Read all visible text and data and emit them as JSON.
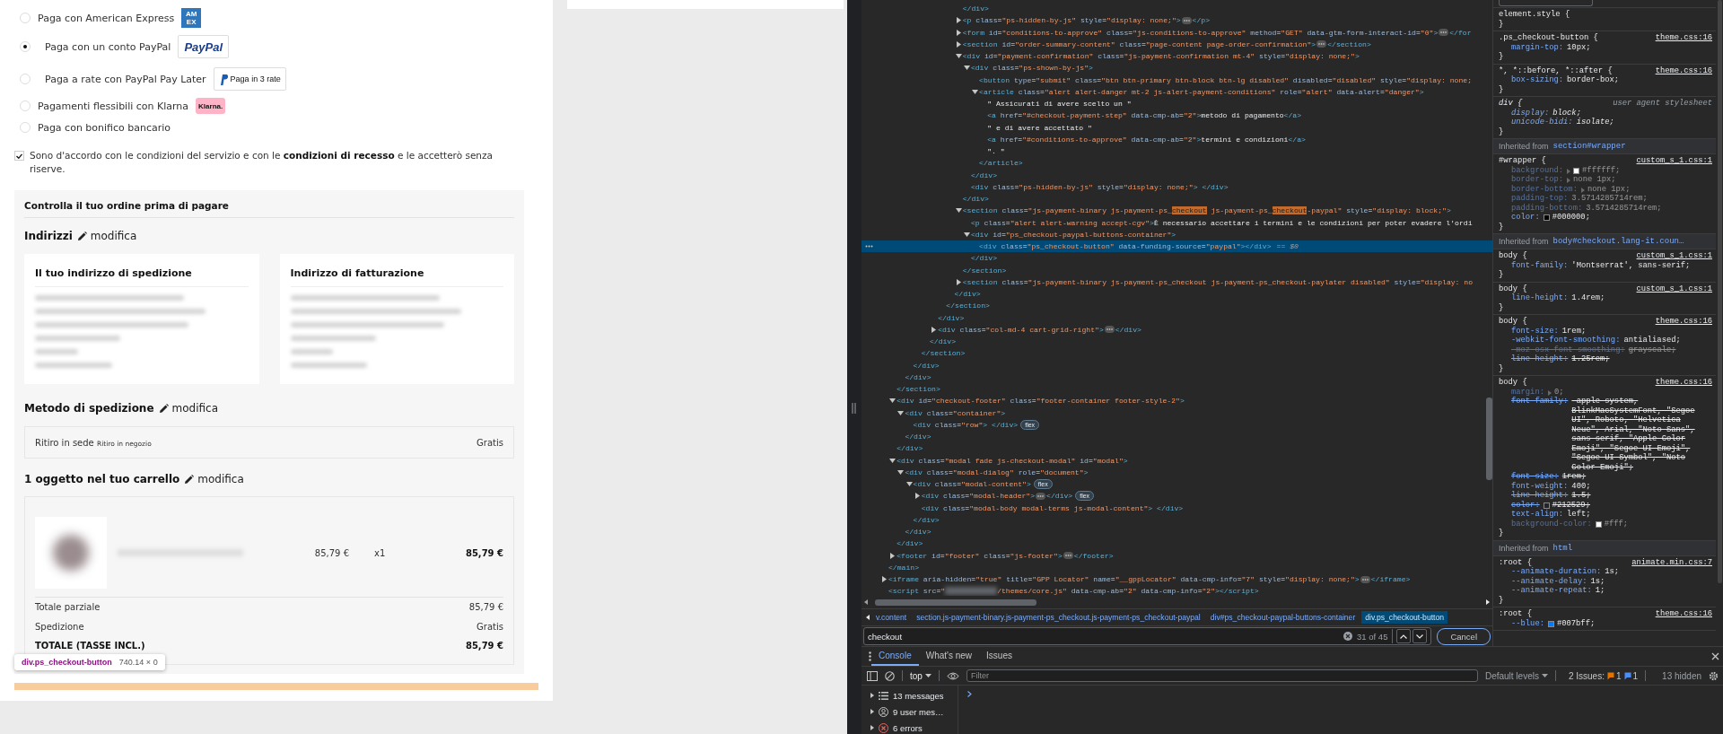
{
  "checkout": {
    "payment_options": [
      {
        "label": "Paga con American Express",
        "selected": false,
        "kind": "amex",
        "logo_text": "AMEX"
      },
      {
        "label": "Paga con un conto PayPal",
        "selected": true,
        "kind": "paypal",
        "logo_text": "PayPal"
      },
      {
        "label": "Paga a rate con PayPal Pay Later",
        "selected": false,
        "kind": "paylater",
        "logo_text": "Paga in 3 rate"
      },
      {
        "label": "Pagamenti flessibili con Klarna",
        "selected": false,
        "kind": "klarna",
        "logo_text": "Klarna."
      },
      {
        "label": "Paga con bonifico bancario",
        "selected": false,
        "kind": "plain"
      }
    ],
    "terms": {
      "checked": true,
      "parts": [
        {
          "kind": "text",
          "text": "Sono d'accordo con le "
        },
        {
          "kind": "link",
          "text": "condizioni del servizio"
        },
        {
          "kind": "text",
          "text": " e con le "
        },
        {
          "kind": "strong_link",
          "text": "condizioni di recesso"
        },
        {
          "kind": "text",
          "text": " e le accetterò senza riserve."
        }
      ]
    },
    "review_title": "Controlla il tuo ordine prima di pagare",
    "addresses": {
      "heading": "Indirizzi",
      "edit": "modifica",
      "cards": [
        {
          "title": "Il tuo indirizzo di spedizione"
        },
        {
          "title": "Indirizzo di fatturazione"
        }
      ]
    },
    "shipping": {
      "heading": "Metodo di spedizione",
      "edit": "modifica",
      "carrier": "Ritiro in sede",
      "delay": "Ritiro in negozio",
      "price": "Gratis"
    },
    "cart": {
      "heading": "1 oggetto nel tuo carrello",
      "edit": "modifica",
      "items": [
        {
          "unit_price": "85,79 €",
          "quantity": "x1",
          "total": "85,79 €"
        }
      ],
      "totals": [
        {
          "label": "Totale parziale",
          "value": "85,79 €",
          "kind": "plain"
        },
        {
          "label": "Spedizione",
          "value": "Gratis",
          "kind": "plain"
        },
        {
          "label": "TOTALE (TASSE INCL.)",
          "value": "85,79 €",
          "kind": "grand"
        }
      ]
    },
    "inspect_tooltip": {
      "selector": "div.ps_checkout-button",
      "size": "740.14 × 0"
    }
  },
  "devtools": {
    "dom_tree": [
      {
        "close": "</main>",
        "children": [
          {
            "close": "</section>",
            "children": [
              {
                "close": "</div>",
                "children": [
                  {
                    "close": "</div>",
                    "children": [
                      {
                        "close": "</section>",
                        "children": [
                          {
                            "close": "</div>",
                            "children": [
                              {
                                "close": "</div>",
                                "children": [
                                  {
                                    "close": "</section>",
                                    "children": [
                                      {
                                        "close": "</div>",
                                        "children": [
                                          {
                                            "close": "</div>"
                                          },
                                          {
                                            "open": "<p class=\"ps-hidden-by-js\" style=\"display: none;\">",
                                            "expanded": false,
                                            "close": "</p>",
                                            "selected": false
                                          },
                                          {
                                            "open": "<form id=\"conditions-to-approve\" class=\"js-conditions-to-approve\" method=\"GET\" data-gtm-form-interact-id=\"0\">",
                                            "expanded": false,
                                            "close": "</for",
                                            "selected": false
                                          },
                                          {
                                            "open": "<section id=\"order-summary-content\" class=\"page-content page-order-confirmation\">",
                                            "expanded": false,
                                            "close": "</section>",
                                            "selected": false
                                          },
                                          {
                                            "open": "<div id=\"payment-confirmation\" class=\"js-payment-confirmation mt-4\" style=\"display: none;\">",
                                            "expanded": true,
                                            "close": "</div>",
                                            "selected": false,
                                            "children": [
                                              {
                                                "open": "<div class=\"ps-shown-by-js\">",
                                                "expanded": true,
                                                "close": "</div>",
                                                "selected": false,
                                                "children": [
                                                  {
                                                    "open": "<button type=\"submit\" class=\"btn btn-primary btn-block btn-lg disabled\" disabled=\"disabled\" style=\"display: none;",
                                                    "selected": false
                                                  },
                                                  {
                                                    "open": "<article class=\"alert alert-danger mt-2 js-alert-payment-conditions\" role=\"alert\" data-alert=\"danger\">",
                                                    "expanded": true,
                                                    "close": "</article>",
                                                    "selected": false,
                                                    "children": [
                                                      {
                                                        "open": "\" Assicurati di avere scelto un \"",
                                                        "kind": "text",
                                                        "selected": false
                                                      },
                                                      {
                                                        "open": "<a href=\"#checkout-payment-step\" data-cmp-ab=\"2\">metodo di pagamento</a>",
                                                        "kind": "element",
                                                        "selected": false
                                                      },
                                                      {
                                                        "open": "\" e di avere accettato \"",
                                                        "kind": "text",
                                                        "selected": false
                                                      },
                                                      {
                                                        "open": "<a href=\"#conditions-to-approve\" data-cmp-ab=\"2\">termini e condizioni</a>",
                                                        "kind": "element",
                                                        "selected": false
                                                      },
                                                      {
                                                        "open": "\". \"",
                                                        "kind": "text",
                                                        "selected": false
                                                      }
                                                    ]
                                                  }
                                                ]
                                              },
                                              {
                                                "open": "<div class=\"ps-hidden-by-js\" style=\"display: none;\"> </div>",
                                                "selected": false
                                              }
                                            ]
                                          },
                                          {
                                            "segments": [
                                              {
                                                "text": "<section class=\"js-payment-binary js-payment-ps_",
                                                "highlight": false
                                              },
                                              {
                                                "text": "checkout",
                                                "highlight": true
                                              },
                                              {
                                                "text": " js-payment-ps_",
                                                "highlight": false
                                              },
                                              {
                                                "text": "checkout",
                                                "highlight": true
                                              },
                                              {
                                                "text": "-paypal\" style=\"display: block;\">",
                                                "highlight": false
                                              }
                                            ],
                                            "expanded": true,
                                            "close": "</section>",
                                            "selected": false,
                                            "children": [
                                              {
                                                "open": "<p class=\"alert alert-warning accept-cgv\">È necessario accettare i termini e le condizioni per poter evadere l'ordi",
                                                "selected": false
                                              },
                                              {
                                                "open": "<div id=\"ps_checkout-paypal-buttons-container\">",
                                                "expanded": true,
                                                "close": "</div>",
                                                "selected": false,
                                                "children": [
                                                  {
                                                    "open": "<div class=\"ps_checkout-button\" data-funding-source=\"paypal\"></div>",
                                                    "selected": true,
                                                    "marker": "== $0"
                                                  }
                                                ]
                                              }
                                            ]
                                          },
                                          {
                                            "open": "<section class=\"js-payment-binary js-payment-ps_checkout js-payment-ps_checkout-paylater disabled\" style=\"display: no",
                                            "expanded": false,
                                            "selected": false
                                          }
                                        ]
                                      }
                                    ]
                                  }
                                ]
                              },
                              {
                                "open": "<div class=\"col-md-4 cart-grid-right\">",
                                "expanded": false,
                                "close": "</div>",
                                "selected": false
                              }
                            ]
                          }
                        ]
                      }
                    ]
                  }
                ]
              }
            ]
          },
          {
            "open": "<div id=\"checkout-footer\" class=\"footer-container footer-style-2\">",
            "expanded": true,
            "close": "</div>",
            "selected": false,
            "children": [
              {
                "open": "<div class=\"container\">",
                "expanded": true,
                "close": "</div>",
                "selected": false,
                "children": [
                  {
                    "open": "<div class=\"row\"> </div>",
                    "badge": "flex",
                    "selected": false
                  }
                ]
              }
            ]
          },
          {
            "open": "<div class=\"modal fade js-checkout-modal\" id=\"modal\">",
            "expanded": true,
            "close": "</div>",
            "selected": false,
            "children": [
              {
                "open": "<div class=\"modal-dialog\" role=\"document\">",
                "expanded": true,
                "close": "</div>",
                "selected": false,
                "children": [
                  {
                    "open": "<div class=\"modal-content\">",
                    "expanded": true,
                    "close": "</div>",
                    "badge": "flex",
                    "selected": false,
                    "children": [
                      {
                        "open": "<div class=\"modal-header\">",
                        "expanded": false,
                        "close": "</div>",
                        "badge": "flex",
                        "selected": false
                      },
                      {
                        "open": "<div class=\"modal-body modal-terms js-modal-content\"> </div>",
                        "selected": false
                      }
                    ]
                  }
                ]
              }
            ]
          },
          {
            "open": "<footer id=\"footer\" class=\"js-footer\">",
            "expanded": false,
            "close": "</footer>",
            "selected": false
          }
        ]
      },
      {
        "open": "<iframe aria-hidden=\"true\" title=\"GPP Locator\" name=\"__gppLocator\" data-cmp-info=\"7\" style=\"display: none;\">",
        "expanded": false,
        "close": "</iframe>",
        "selected": false
      },
      {
        "open": "<script src=\"",
        "open_after_blur": "/themes/core.js\" data-cmp-ab=\"2\" data-cmp-info=\"2\"></script>",
        "selected": false
      }
    ],
    "breadcrumbs": [
      {
        "label": "v.content",
        "selected": false
      },
      {
        "label": "section.js-payment-binary.js-payment-ps_checkout.js-payment-ps_checkout-paypal",
        "selected": false
      },
      {
        "label": "div#ps_checkout-paypal-buttons-container",
        "selected": false
      },
      {
        "label": "div.ps_checkout-button",
        "selected": true
      }
    ],
    "search": {
      "value": "checkout",
      "count": "31 of 45",
      "cancel": "Cancel"
    },
    "styles": [
      {
        "kind": "rule",
        "selector": "element.style {",
        "close": "}",
        "user_agent": false
      },
      {
        "kind": "rule",
        "selector": ".ps_checkout-button {",
        "source": "theme.css:16",
        "close": "}",
        "user_agent": false,
        "declarations": [
          {
            "property": "margin-top:",
            "value": "10px;",
            "inactive": false,
            "overridden": false
          }
        ]
      },
      {
        "kind": "rule",
        "selector": "*, *::before, *::after {",
        "source": "theme.css:16",
        "close": "}",
        "user_agent": false,
        "declarations": [
          {
            "property": "box-sizing:",
            "value": "border-box;",
            "inactive": false,
            "overridden": false
          }
        ]
      },
      {
        "kind": "rule",
        "selector": "div {",
        "source": "user agent stylesheet",
        "close": "}",
        "user_agent": true,
        "declarations": [
          {
            "property": "display:",
            "value": "block;",
            "inactive": false,
            "overridden": false
          },
          {
            "property": "unicode-bidi:",
            "value": "isolate;",
            "inactive": false,
            "overridden": false
          }
        ]
      },
      {
        "kind": "inherited",
        "label": "Inherited from",
        "target": "section#wrapper"
      },
      {
        "kind": "rule",
        "selector": "#wrapper {",
        "source": "custom_s_1.css:1",
        "close": "}",
        "user_agent": false,
        "declarations": [
          {
            "property": "background:",
            "value": "#ffffff;",
            "inactive": true,
            "overridden": false,
            "expandable": true,
            "color": "#ffffff"
          },
          {
            "property": "border-top:",
            "value": "none 1px;",
            "inactive": true,
            "overridden": false,
            "expandable": true
          },
          {
            "property": "border-bottom:",
            "value": "none 1px;",
            "inactive": true,
            "overridden": false,
            "expandable": true
          },
          {
            "property": "padding-top:",
            "value": "3.5714285714rem;",
            "inactive": true,
            "overridden": false
          },
          {
            "property": "padding-bottom:",
            "value": "3.5714285714rem;",
            "inactive": true,
            "overridden": false
          },
          {
            "property": "color:",
            "value": "#000000;",
            "inactive": false,
            "overridden": false,
            "color": "#000000"
          }
        ]
      },
      {
        "kind": "inherited",
        "label": "Inherited from",
        "target": "body#checkout.lang-it.coun…"
      },
      {
        "kind": "rule",
        "selector": "body {",
        "source": "custom_s_1.css:1",
        "close": "}",
        "user_agent": false,
        "declarations": [
          {
            "property": "font-family:",
            "value": "'Montserrat', sans-serif;",
            "inactive": false,
            "overridden": false
          }
        ]
      },
      {
        "kind": "rule",
        "selector": "body {",
        "source": "custom_s_1.css:1",
        "close": "}",
        "user_agent": false,
        "declarations": [
          {
            "property": "line-height:",
            "value": "1.4rem;",
            "inactive": false,
            "overridden": false
          }
        ]
      },
      {
        "kind": "rule",
        "selector": "body {",
        "source": "theme.css:16",
        "close": "}",
        "user_agent": false,
        "declarations": [
          {
            "property": "font-size:",
            "value": "1rem;",
            "inactive": false,
            "overridden": false
          },
          {
            "property": "-webkit-font-smoothing:",
            "value": "antialiased;",
            "inactive": false,
            "overridden": false
          },
          {
            "property": "-moz-osx-font-smoothing:",
            "value": "grayscale;",
            "inactive": true,
            "overridden": true
          },
          {
            "property": "line-height:",
            "value": "1.25rem;",
            "inactive": false,
            "overridden": true
          }
        ]
      },
      {
        "kind": "rule",
        "selector": "body {",
        "source": "theme.css:16",
        "close": "}",
        "user_agent": false,
        "declarations": [
          {
            "property": "margin:",
            "value": "0;",
            "inactive": true,
            "overridden": false,
            "expandable": true
          },
          {
            "property": "font-family:",
            "value": "-apple-system, BlinkMacSystemFont, \"Segoe UI\", Roboto, \"Helvetica Neue\", Arial, \"Noto Sans\", sans-serif, \"Apple Color Emoji\", \"Segoe UI Emoji\", \"Segoe UI Symbol\", \"Noto Color Emoji\";",
            "inactive": false,
            "overridden": true
          },
          {
            "property": "font-size:",
            "value": "1rem;",
            "inactive": false,
            "overridden": true
          },
          {
            "property": "font-weight:",
            "value": "400;",
            "inactive": false,
            "overridden": false
          },
          {
            "property": "line-height:",
            "value": "1.5;",
            "inactive": false,
            "overridden": true
          },
          {
            "property": "color:",
            "value": "#212529;",
            "inactive": false,
            "overridden": true,
            "color": "#212529"
          },
          {
            "property": "text-align:",
            "value": "left;",
            "inactive": false,
            "overridden": false
          },
          {
            "property": "background-color:",
            "value": "#fff;",
            "inactive": true,
            "overridden": false,
            "color": "#ffffff"
          }
        ]
      },
      {
        "kind": "inherited",
        "label": "Inherited from",
        "target": "html"
      },
      {
        "kind": "rule",
        "selector": ":root {",
        "source": "animate.min.css:7",
        "close": "}",
        "user_agent": false,
        "declarations": [
          {
            "property": "--animate-duration:",
            "value": "1s;",
            "inactive": false,
            "overridden": false
          },
          {
            "property": "--animate-delay:",
            "value": "1s;",
            "inactive": false,
            "overridden": false
          },
          {
            "property": "--animate-repeat:",
            "value": "1;",
            "inactive": false,
            "overridden": false
          }
        ]
      },
      {
        "kind": "rule",
        "selector": ":root {",
        "source": "theme.css:16",
        "user_agent": false,
        "declarations": [
          {
            "property": "--blue:",
            "value": "#007bff;",
            "inactive": false,
            "overridden": false,
            "color": "#007bff"
          }
        ]
      }
    ],
    "drawer": {
      "tabs": [
        {
          "label": "Console",
          "selected": true
        },
        {
          "label": "What's new",
          "selected": false
        },
        {
          "label": "Issues",
          "selected": false
        }
      ],
      "context": "top",
      "filter_placeholder": "Filter",
      "levels": "Default levels",
      "issues_label": "2 Issues:",
      "issue_counts": [
        {
          "count": "1",
          "kind": "warning"
        },
        {
          "count": "1",
          "kind": "info"
        }
      ],
      "hidden": "13 hidden",
      "sidebar": [
        {
          "label": "13 messages",
          "kind": "all"
        },
        {
          "label": "9 user mes…",
          "kind": "user"
        },
        {
          "label": "6 errors",
          "kind": "error"
        }
      ]
    }
  }
}
